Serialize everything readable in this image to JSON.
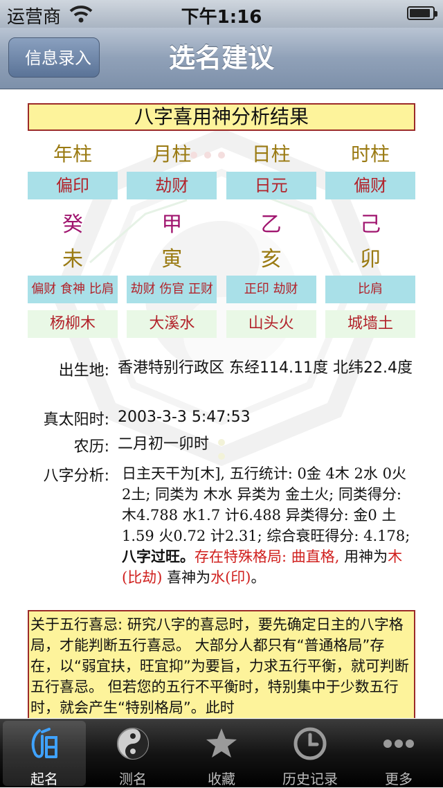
{
  "status": {
    "carrier": "运营商",
    "time": "下午1:16",
    "battery_level": 0.9
  },
  "nav": {
    "back_label": "信息录入",
    "title": "选名建议"
  },
  "result": {
    "header": "八字喜用神分析结果",
    "pillars": [
      {
        "name": "年柱",
        "ten_god": "偏印",
        "stem": "癸",
        "branch": "未",
        "hidden": "偏财 食神 比肩",
        "nayin": "杨柳木"
      },
      {
        "name": "月柱",
        "ten_god": "劫财",
        "stem": "甲",
        "branch": "寅",
        "hidden": "劫财 伤官 正财",
        "nayin": "大溪水"
      },
      {
        "name": "日柱",
        "ten_god": "日元",
        "stem": "乙",
        "branch": "亥",
        "hidden": "正印 劫财",
        "nayin": "山头火"
      },
      {
        "name": "时柱",
        "ten_god": "偏财",
        "stem": "己",
        "branch": "卯",
        "hidden": "比肩",
        "nayin": "城墙土"
      }
    ]
  },
  "info": {
    "birthplace_label": "出生地:",
    "birthplace_value": "香港特别行政区 东经114.11度 北纬22.4度",
    "solar_label": "真太阳时:",
    "solar_value": "2003-3-3 5:47:53",
    "lunar_label": "农历:",
    "lunar_value": "二月初一卯时",
    "analysis_label": "八字分析:",
    "analysis_1": "日主天干为[木], 五行统计: 0金 4木 2水 0火 2土; 同类为 木水 异类为 金土火; 同类得分: 木4.788 水1.7 计6.488 异类得分: 金0 土1.59 火0.72 计2.31; 综合衰旺得分: 4.178;",
    "analysis_bold": "八字过旺。",
    "analysis_red1": "存在特殊格局: 曲直格,",
    "analysis_2": "用神为",
    "analysis_red2": "木(比劫)",
    "analysis_3": "喜神为",
    "analysis_red3": "水(印)",
    "analysis_4": "。"
  },
  "note": {
    "text": "关于五行喜忌: 研究八字的喜忌时，要先确定日主的八字格局，才能判断五行喜忌。 大部分人都只有“普通格局”存在，以“弱宜扶，旺宜抑”为要旨，力求五行平衡，就可判断五行喜忌。 但若您的五行不平衡时，特别集中于少数五行时，就会产生“特别格局”。此时"
  },
  "tabs": [
    {
      "label": "起名",
      "icon": "name-icon"
    },
    {
      "label": "测名",
      "icon": "yin-yang-icon"
    },
    {
      "label": "收藏",
      "icon": "star-icon"
    },
    {
      "label": "历史记录",
      "icon": "clock-icon"
    },
    {
      "label": "更多",
      "icon": "more-icon"
    }
  ]
}
